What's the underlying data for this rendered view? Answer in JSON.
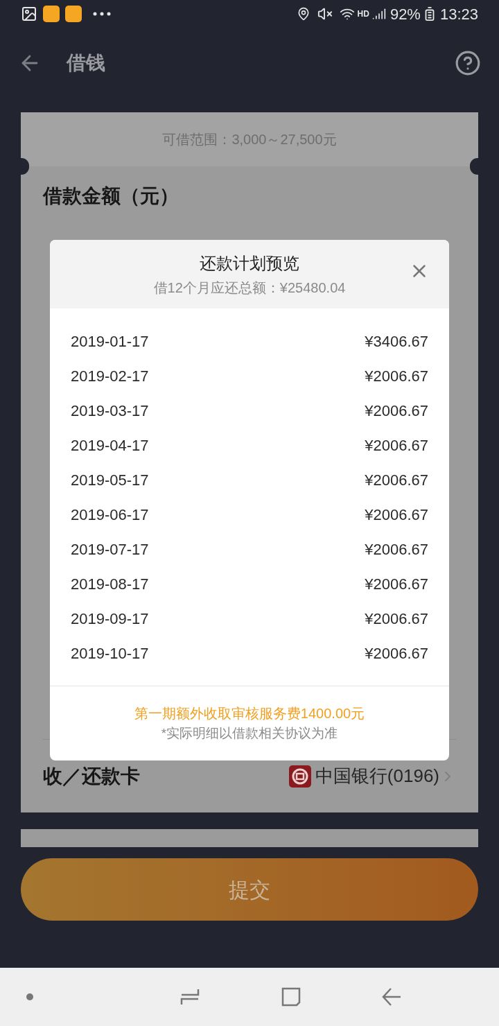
{
  "status_bar": {
    "battery": "92%",
    "time": "13:23",
    "network": "HD"
  },
  "header": {
    "title": "借钱"
  },
  "loan_card": {
    "range": "可借范围：3,000～27,500元",
    "amount_label": "借款金额（元）",
    "card_label": "收／还款卡",
    "bank": "中国银行(0196)"
  },
  "submit_button": {
    "label": "提交",
    "disabled": true
  },
  "dialog": {
    "title": "还款计划预览",
    "subtitle": "借12个月应还总额：¥25480.04",
    "rows": [
      {
        "date": "2019-01-17",
        "amount": "¥3406.67"
      },
      {
        "date": "2019-02-17",
        "amount": "¥2006.67"
      },
      {
        "date": "2019-03-17",
        "amount": "¥2006.67"
      },
      {
        "date": "2019-04-17",
        "amount": "¥2006.67"
      },
      {
        "date": "2019-05-17",
        "amount": "¥2006.67"
      },
      {
        "date": "2019-06-17",
        "amount": "¥2006.67"
      },
      {
        "date": "2019-07-17",
        "amount": "¥2006.67"
      },
      {
        "date": "2019-08-17",
        "amount": "¥2006.67"
      },
      {
        "date": "2019-09-17",
        "amount": "¥2006.67"
      },
      {
        "date": "2019-10-17",
        "amount": "¥2006.67"
      }
    ],
    "notice": "第一期额外收取审核服务费1400.00元",
    "disclaimer": "*实际明细以借款相关协议为准"
  }
}
